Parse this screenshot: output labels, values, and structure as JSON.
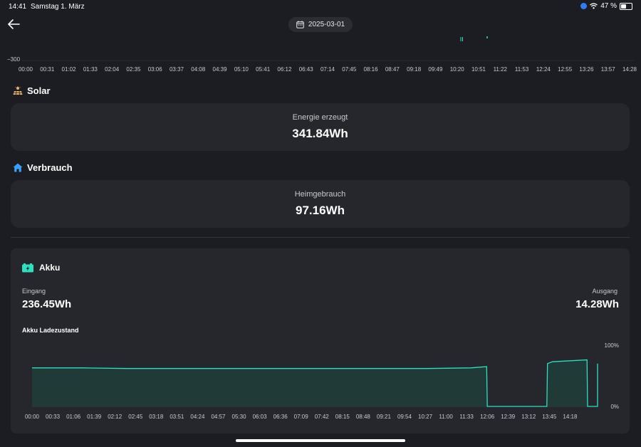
{
  "status_bar": {
    "time": "14:41",
    "date": "Samstag 1. März",
    "battery_percent": "47 %",
    "battery_level": 0.47
  },
  "header": {
    "date": "2025-03-01"
  },
  "power_chart": {
    "y_tick": "−300",
    "x_ticks": [
      "00:00",
      "00:31",
      "01:02",
      "01:33",
      "02:04",
      "02:35",
      "03:06",
      "03:37",
      "04:08",
      "04:39",
      "05:10",
      "05:41",
      "06:12",
      "06:43",
      "07:14",
      "07:45",
      "08:16",
      "08:47",
      "09:18",
      "09:49",
      "10:20",
      "10:51",
      "11:22",
      "11:53",
      "12:24",
      "12:55",
      "13:26",
      "13:57",
      "14:28"
    ]
  },
  "solar": {
    "title": "Solar",
    "label": "Energie erzeugt",
    "value": "341.84Wh"
  },
  "consumption": {
    "title": "Verbrauch",
    "label": "Heimgebrauch",
    "value": "97.16Wh"
  },
  "akku": {
    "title": "Akku",
    "input_label": "Eingang",
    "input_value": "236.45Wh",
    "output_label": "Ausgang",
    "output_value": "14.28Wh",
    "soc_title": "Akku Ladezustand"
  },
  "colors": {
    "accent": "#2de0c0",
    "background": "#1c1d22",
    "card": "#26272d",
    "home_icon": "#3aa0ff",
    "solar_icon": "#e8b26a"
  },
  "chart_data": {
    "type": "area",
    "title": "Akku Ladezustand",
    "xlabel": "",
    "ylabel": "",
    "ylim": [
      0,
      100
    ],
    "y_tick_labels": [
      "100%",
      "0%"
    ],
    "x_tick_labels": [
      "00:00",
      "00:33",
      "01:06",
      "01:39",
      "02:12",
      "02:45",
      "03:18",
      "03:51",
      "04:24",
      "04:57",
      "05:30",
      "06:03",
      "06:36",
      "07:09",
      "07:42",
      "08:15",
      "08:48",
      "09:21",
      "09:54",
      "10:27",
      "11:00",
      "11:33",
      "12:06",
      "12:39",
      "13:12",
      "13:45",
      "14:18"
    ],
    "x_unit": "minutes since 00:00",
    "x_range": [
      0,
      878
    ],
    "series": [
      {
        "x": [
          0,
          80,
          150,
          630,
          700,
          725,
          726,
          821,
          822,
          830,
          885,
          886,
          946,
          947,
          1155,
          1156,
          1185,
          1186,
          1234
        ],
        "values": [
          63,
          63,
          62,
          62,
          63,
          65,
          0,
          0,
          70,
          73,
          76,
          0,
          0,
          70,
          70,
          0,
          0,
          0,
          0
        ]
      }
    ]
  }
}
